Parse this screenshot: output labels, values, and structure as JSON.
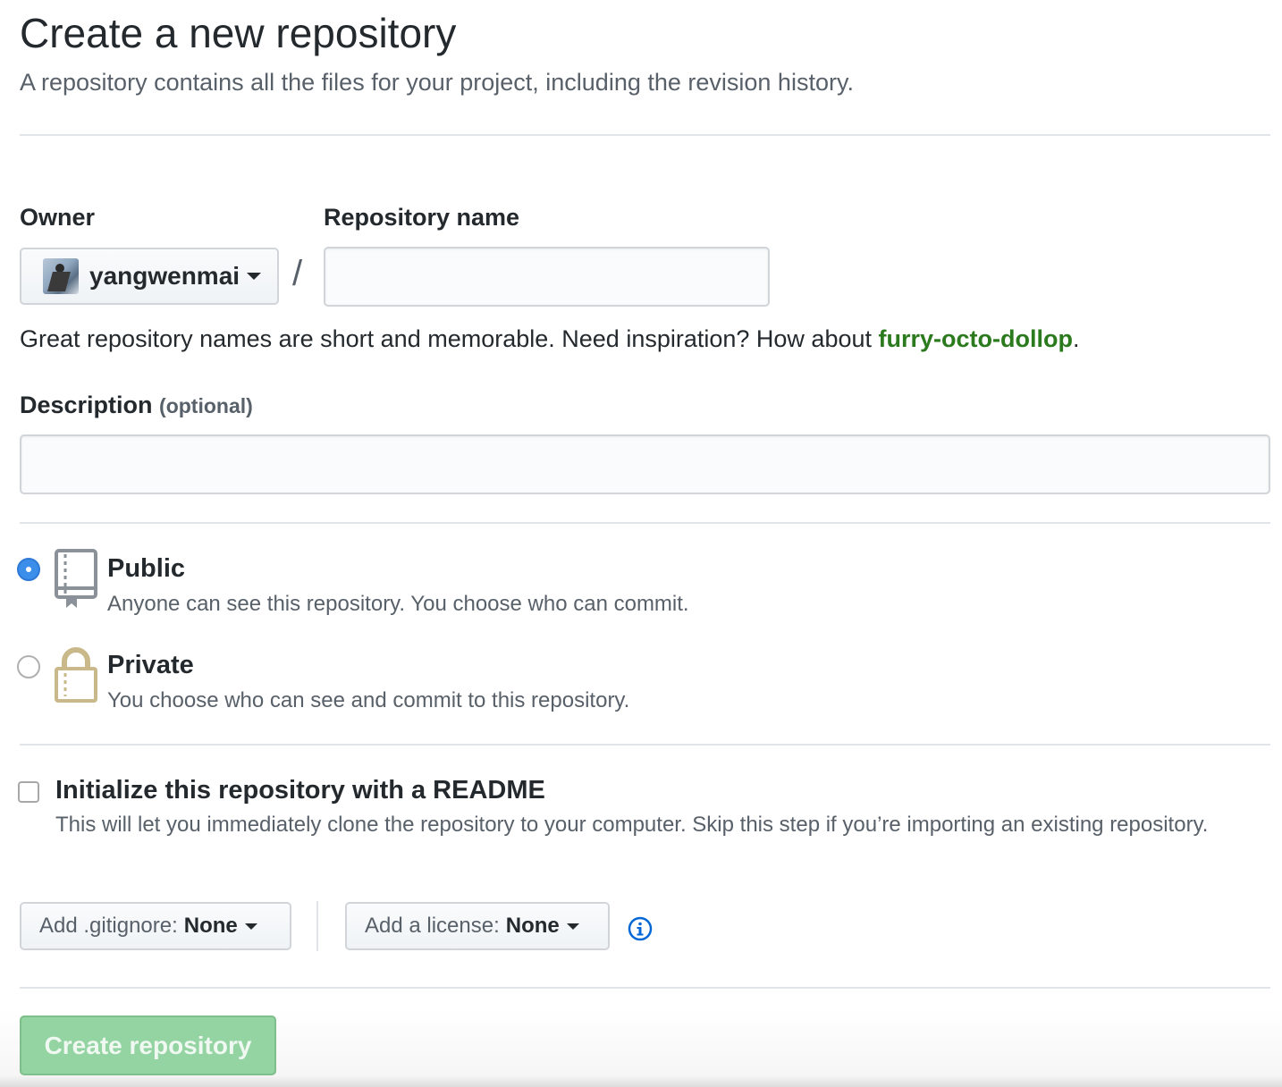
{
  "header": {
    "title": "Create a new repository",
    "subtitle": "A repository contains all the files for your project, including the revision history."
  },
  "owner": {
    "label": "Owner",
    "value": "yangwenmai",
    "avatar_icon": "user-avatar"
  },
  "separator": "/",
  "repo_name": {
    "label": "Repository name",
    "value": "",
    "placeholder": ""
  },
  "hint": {
    "text": "Great repository names are short and memorable. Need inspiration? How about ",
    "suggestion": "furry-octo-dollop",
    "suffix": "."
  },
  "description": {
    "label": "Description",
    "optional": "(optional)",
    "value": "",
    "placeholder": ""
  },
  "visibility": {
    "options": [
      {
        "title": "Public",
        "description": "Anyone can see this repository. You choose who can commit.",
        "icon": "repo-icon",
        "selected": true
      },
      {
        "title": "Private",
        "description": "You choose who can see and commit to this repository.",
        "icon": "lock-icon",
        "selected": false
      }
    ]
  },
  "readme": {
    "title": "Initialize this repository with a README",
    "description": "This will let you immediately clone the repository to your computer. Skip this step if you’re importing an existing repository.",
    "checked": false
  },
  "gitignore": {
    "label": "Add .gitignore:",
    "value": "None"
  },
  "license": {
    "label": "Add a license:",
    "value": "None",
    "info_icon": "info-icon"
  },
  "submit": {
    "label": "Create repository",
    "disabled": true
  },
  "colors": {
    "link_green": "#2c7a1e",
    "radio_blue": "#3b8eea",
    "submit_disabled": "#94d3a2",
    "info_blue": "#0366d6"
  }
}
